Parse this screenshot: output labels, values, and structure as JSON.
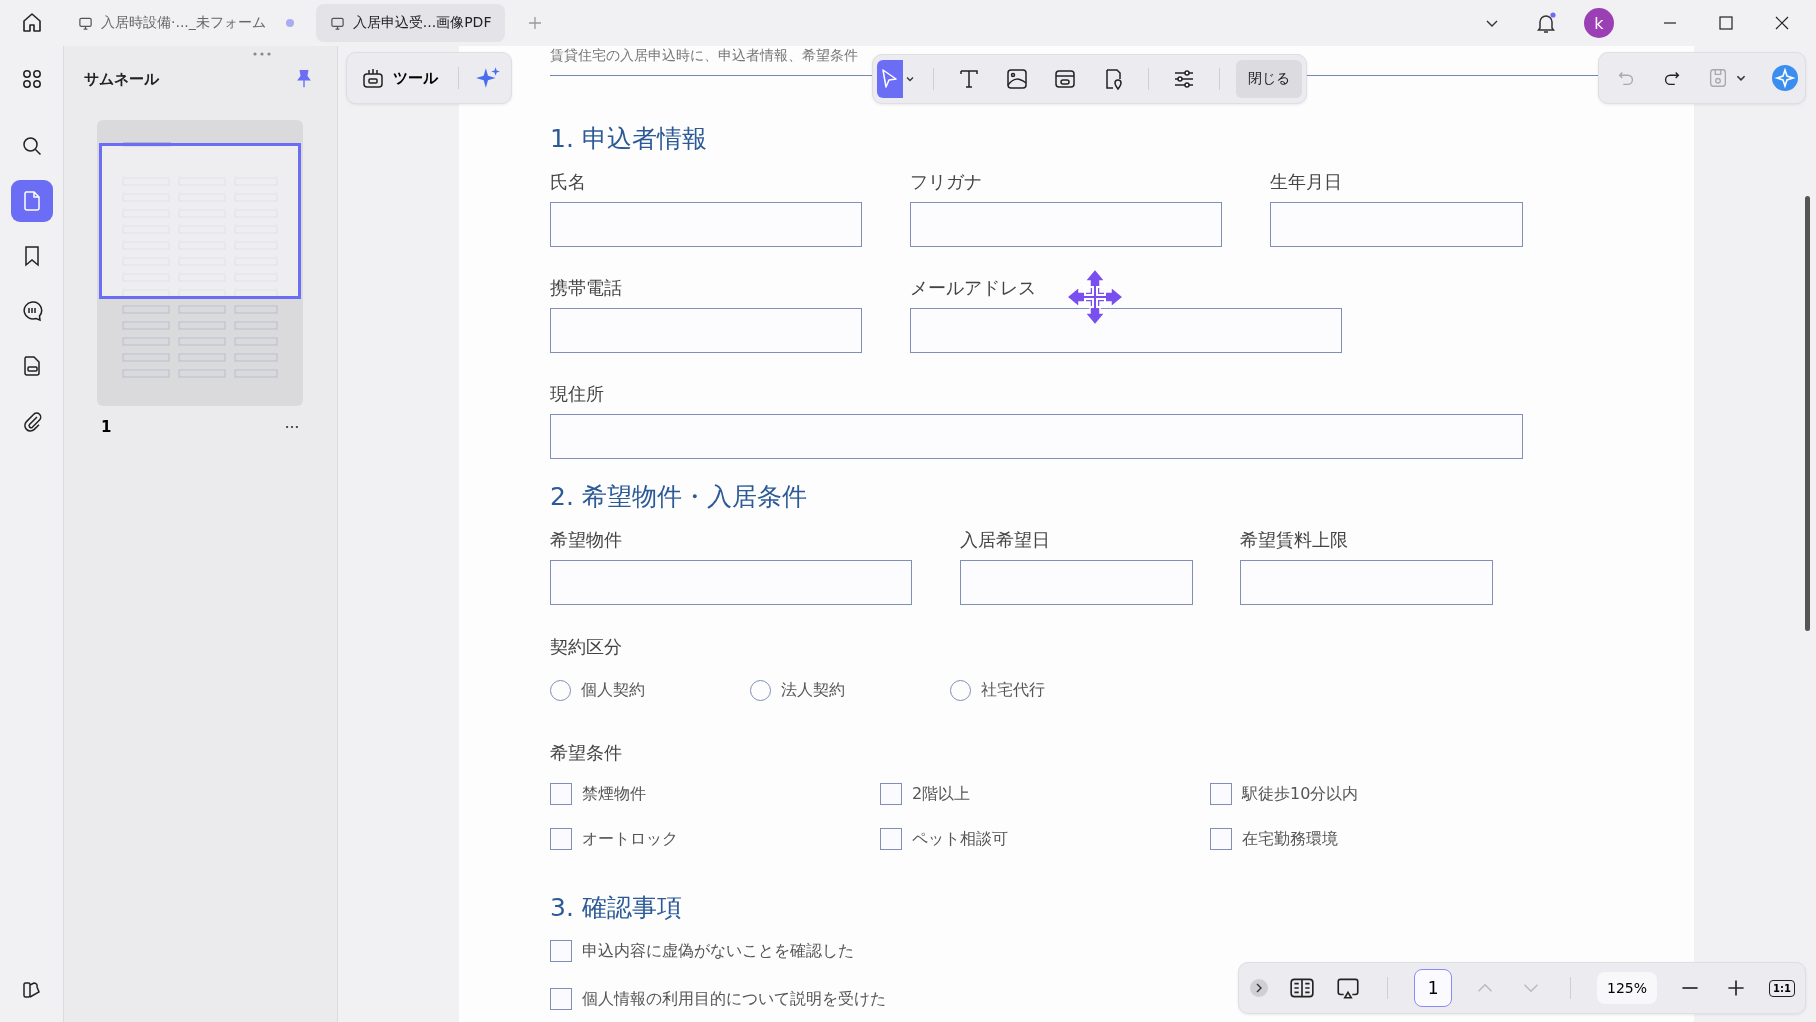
{
  "tabs": [
    {
      "label": "入居時設備·..._未フォーム",
      "selected": false,
      "unsaved": true
    },
    {
      "label": "入居申込受...画像PDF",
      "selected": true,
      "unsaved": false
    }
  ],
  "notifications": {
    "unread": true
  },
  "account": {
    "initial": "k"
  },
  "sidebar": {
    "items": [
      {
        "kind": "apps",
        "selected": false
      },
      {
        "kind": "search",
        "selected": false
      },
      {
        "kind": "pages",
        "selected": true
      },
      {
        "kind": "bookmark",
        "selected": false
      },
      {
        "kind": "comment",
        "selected": false
      },
      {
        "kind": "form",
        "selected": false
      },
      {
        "kind": "attachment",
        "selected": false
      }
    ]
  },
  "thumbnail_panel": {
    "title": "サムネール",
    "pinned": true,
    "pages": [
      {
        "number": "1",
        "selected": true
      }
    ]
  },
  "tools_card": {
    "label": "ツール"
  },
  "edit_toolbar": {
    "tools": [
      {
        "kind": "select",
        "selected": true
      },
      {
        "kind": "text",
        "selected": false
      },
      {
        "kind": "image",
        "selected": false
      },
      {
        "kind": "link",
        "selected": false
      },
      {
        "kind": "location",
        "selected": false
      },
      {
        "kind": "settings",
        "selected": false
      }
    ],
    "close_label": "閉じる"
  },
  "document": {
    "intro": "賃貸住宅の入居申込時に、申込者情報、希望条件",
    "sections": [
      {
        "title": "1. 申込者情報",
        "blocks": [
          {
            "kind": "fields",
            "fields": [
              {
                "label": "氏名"
              },
              {
                "label": "フリガナ"
              },
              {
                "label": "生年月日"
              }
            ]
          },
          {
            "kind": "fields",
            "fields": [
              {
                "label": "携帯電話"
              },
              {
                "label": "メールアドレス"
              }
            ]
          },
          {
            "kind": "fields",
            "fields": [
              {
                "label": "現住所"
              }
            ]
          }
        ]
      },
      {
        "title": "2. 希望物件・入居条件",
        "blocks": [
          {
            "kind": "fields",
            "fields": [
              {
                "label": "希望物件"
              },
              {
                "label": "入居希望日"
              },
              {
                "label": "希望賃料上限"
              }
            ]
          },
          {
            "kind": "radios",
            "label": "契約区分",
            "options": [
              {
                "label": "個人契約",
                "selected": false
              },
              {
                "label": "法人契約",
                "selected": false
              },
              {
                "label": "社宅代行",
                "selected": false
              }
            ]
          },
          {
            "kind": "checkboxes",
            "label": "希望条件",
            "options": [
              {
                "label": "禁煙物件",
                "checked": false
              },
              {
                "label": "2階以上",
                "checked": false
              },
              {
                "label": "駅徒歩10分以内",
                "checked": false
              },
              {
                "label": "オートロック",
                "checked": false
              },
              {
                "label": "ペット相談可",
                "checked": false
              },
              {
                "label": "在宅勤務環境",
                "checked": false
              }
            ]
          }
        ]
      },
      {
        "title": "3. 確認事項",
        "blocks": [
          {
            "kind": "checklist",
            "options": [
              {
                "label": "申込内容に虚偽がないことを確認した",
                "checked": false
              },
              {
                "label": "個人情報の利用目的について説明を受けた",
                "checked": false
              }
            ]
          }
        ]
      }
    ]
  },
  "page_nav": {
    "page": "1",
    "zoom": "125%",
    "actual_size": "1:1"
  }
}
